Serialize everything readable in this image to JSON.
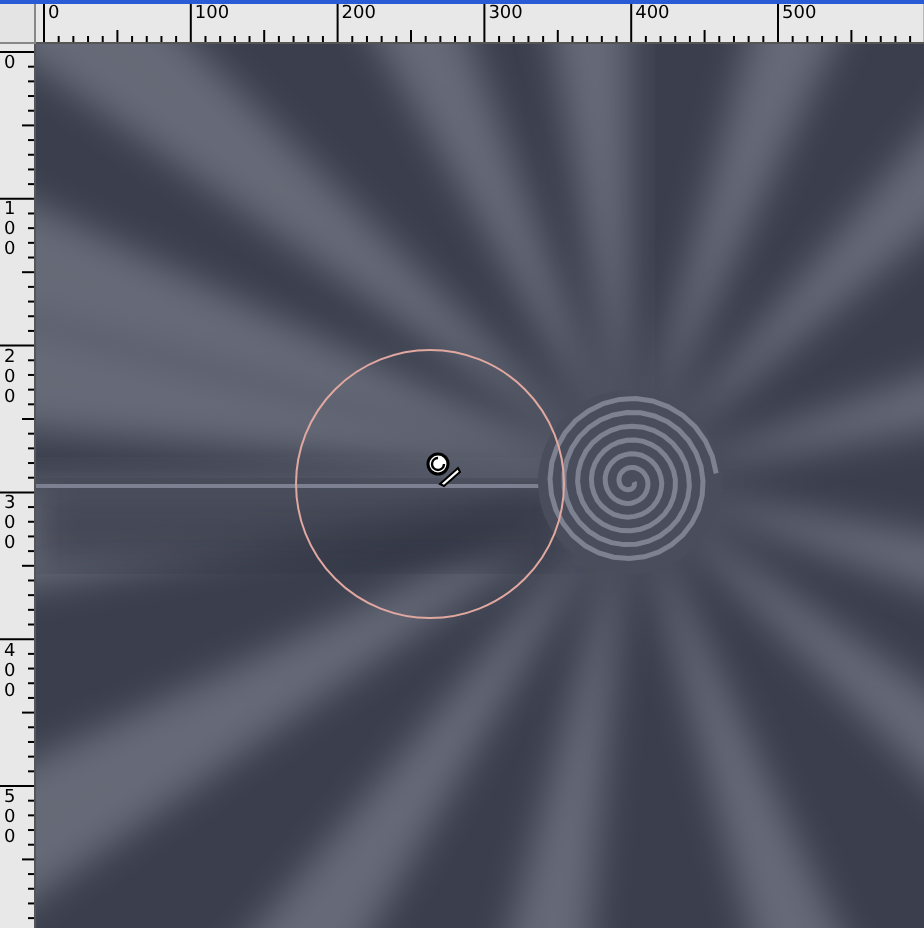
{
  "rulers": {
    "horizontal": [
      "0",
      "100",
      "200",
      "300",
      "400",
      "500"
    ],
    "vertical": [
      "0",
      "100",
      "200",
      "300",
      "400",
      "500"
    ]
  }
}
